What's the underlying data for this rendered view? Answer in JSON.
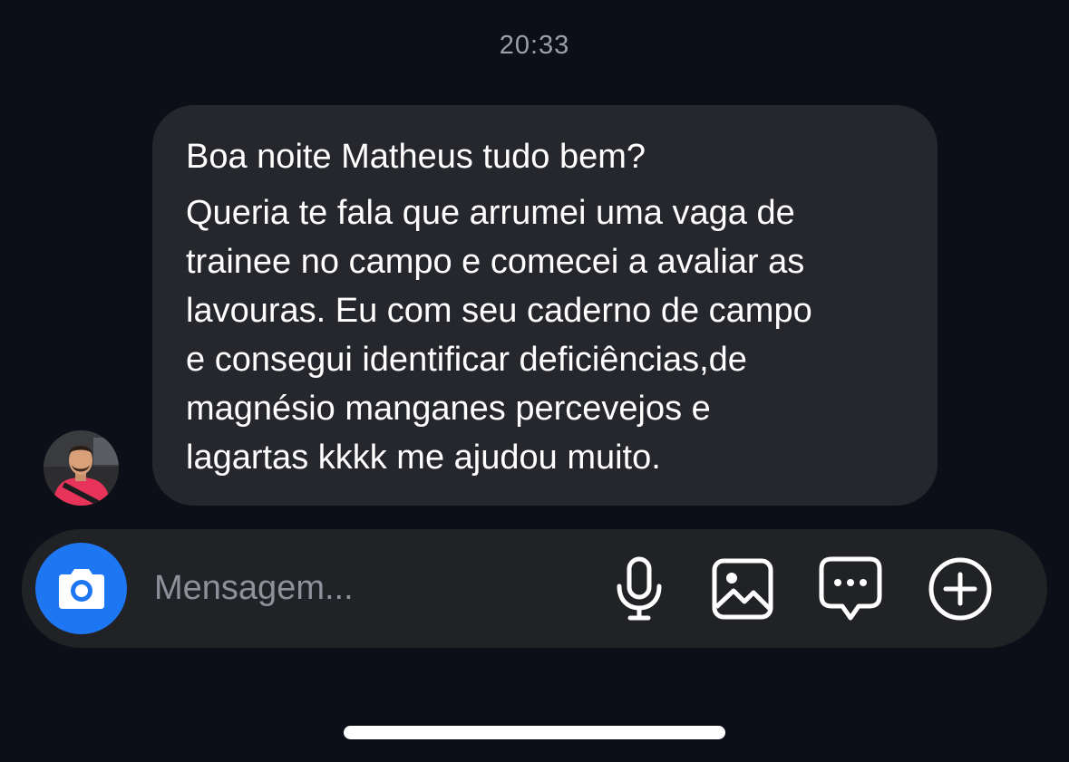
{
  "conversation": {
    "timestamp": "20:33",
    "message": {
      "lines": [
        "Boa noite Matheus tudo bem?",
        "Queria te fala que arrumei uma vaga de",
        "trainee no campo e comecei a avaliar as",
        "lavouras. Eu com seu caderno de campo",
        "e consegui identificar deficiências,de",
        "magnésio manganes percevejos e",
        "lagartas kkkk me ajudou muito."
      ]
    },
    "sender_avatar_icon": "profile-photo"
  },
  "composer": {
    "placeholder": "Mensagem...",
    "value": "",
    "camera_icon": "camera-icon",
    "actions": [
      {
        "name": "microphone",
        "icon": "microphone-icon"
      },
      {
        "name": "gallery",
        "icon": "image-icon"
      },
      {
        "name": "sticker",
        "icon": "chat-bubble-icon"
      },
      {
        "name": "more",
        "icon": "plus-circle-icon"
      }
    ]
  },
  "colors": {
    "background": "#0c0f17",
    "bubble": "#25272c",
    "composer": "#212226",
    "accent": "#1d77f2",
    "timestamp": "#9aa0a8",
    "placeholder": "#8e9199"
  }
}
